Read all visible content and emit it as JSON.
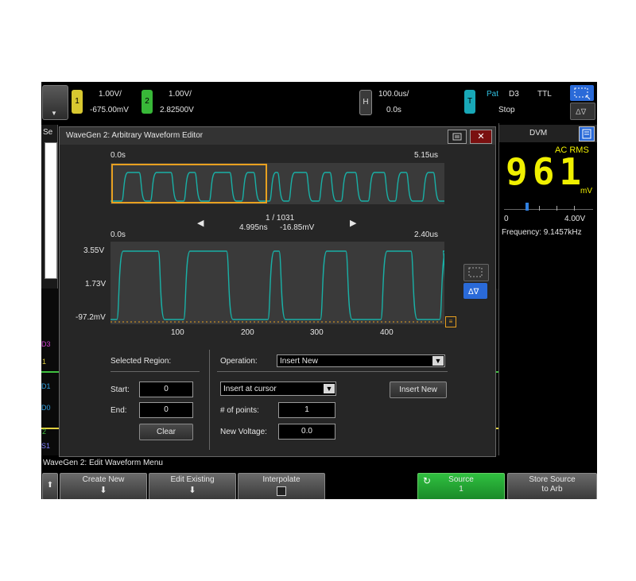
{
  "top_bar": {
    "ch1": {
      "number": "1",
      "scale": "1.00V/",
      "offset": "-675.00mV",
      "color": "#e0d040"
    },
    "ch2": {
      "number": "2",
      "scale": "1.00V/",
      "offset": "2.82500V",
      "color": "#40c040"
    },
    "horizontal": {
      "badge": "H",
      "scale": "100.0us/",
      "delay": "0.0s"
    },
    "trigger": {
      "badge": "T",
      "mode": "Pat",
      "source": "D3",
      "level": "TTL",
      "state": "Stop"
    }
  },
  "left_panel": {
    "label": "Se"
  },
  "digital_labels": [
    "D3",
    "1",
    "D1",
    "D0",
    "2",
    "S1"
  ],
  "dialog": {
    "title": "WaveGen 2: Arbitrary Waveform Editor",
    "overview": {
      "start": "0.0s",
      "end": "5.15us"
    },
    "nav": {
      "point": "1 / 1031",
      "time": "4.995ns",
      "voltage": "-16.85mV"
    },
    "zoom": {
      "start": "0.0s",
      "end": "2.40us",
      "y_labels": [
        "3.55V",
        "1.73V",
        "-97.2mV"
      ],
      "x_ticks": [
        "100",
        "200",
        "300",
        "400"
      ]
    },
    "selected_region": {
      "label": "Selected Region:",
      "start_label": "Start:",
      "start_value": "0",
      "end_label": "End:",
      "end_value": "0",
      "clear": "Clear"
    },
    "operation": {
      "label": "Operation:",
      "value": "Insert New",
      "sub_value": "Insert at cursor",
      "insert_button": "Insert New",
      "points_label": "# of points:",
      "points_value": "1",
      "voltage_label": "New Voltage:",
      "voltage_value": "0.0"
    }
  },
  "dvm": {
    "title": "DVM",
    "mode": "AC RMS",
    "reading": "961",
    "unit": "mV",
    "scale_min": "0",
    "scale_max": "4.00V",
    "frequency": "Frequency: 9.1457kHz",
    "reading_fraction": 0.24
  },
  "softkeys": {
    "menu_title": "WaveGen 2: Edit Waveform Menu",
    "create_new": "Create New",
    "edit_existing": "Edit Existing",
    "interpolate": "Interpolate",
    "source_label": "Source",
    "source_value": "1",
    "store_source": "Store Source",
    "store_to": "to Arb"
  },
  "colors": {
    "trace": "#19b0a6",
    "accent_orange": "#e8a020",
    "dvm_yellow": "#f0f000",
    "active_green": "#1ea030"
  }
}
